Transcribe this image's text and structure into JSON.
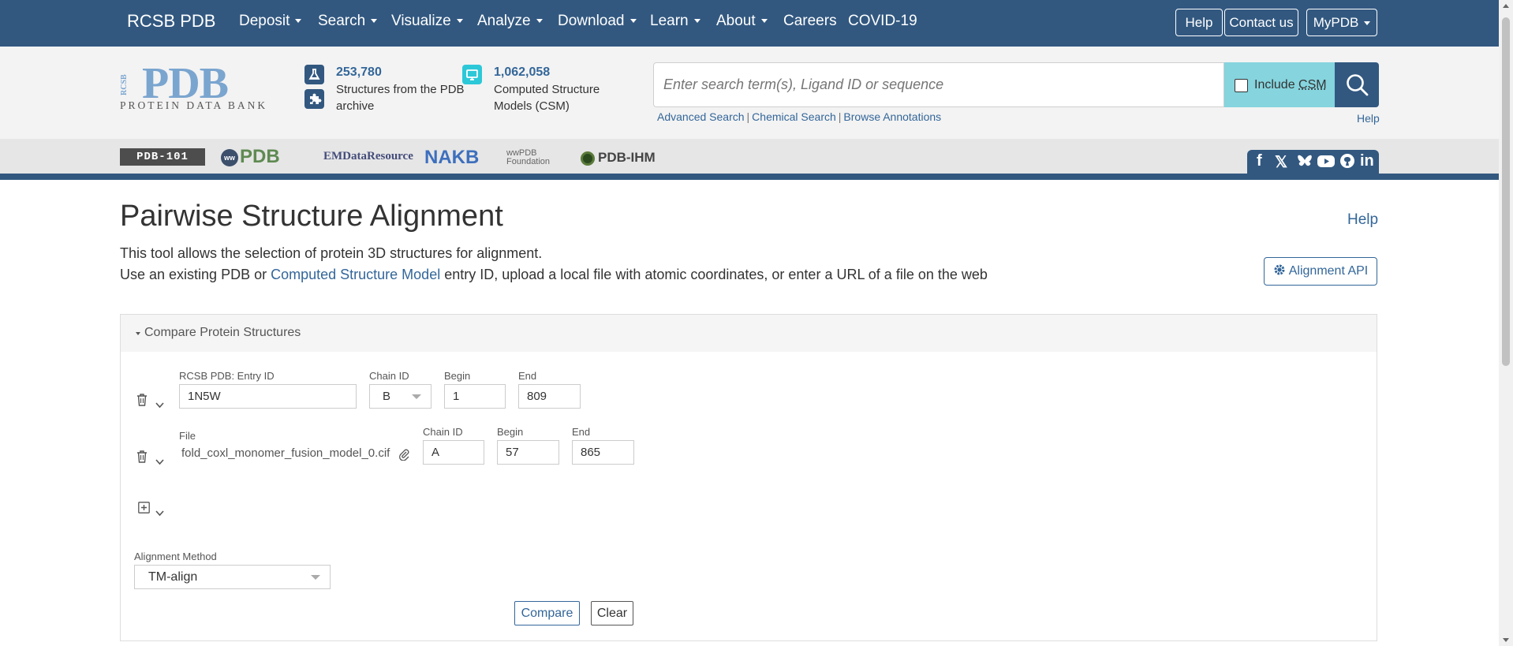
{
  "nav": {
    "brand": "RCSB PDB",
    "items": [
      {
        "label": "Deposit",
        "dropdown": true
      },
      {
        "label": "Search",
        "dropdown": true
      },
      {
        "label": "Visualize",
        "dropdown": true
      },
      {
        "label": "Analyze",
        "dropdown": true
      },
      {
        "label": "Download",
        "dropdown": true
      },
      {
        "label": "Learn",
        "dropdown": true
      },
      {
        "label": "About",
        "dropdown": true
      },
      {
        "label": "Careers",
        "dropdown": false
      },
      {
        "label": "COVID-19",
        "dropdown": false
      }
    ],
    "help_label": "Help",
    "contact_label": "Contact us",
    "mypdb_label": "MyPDB"
  },
  "header": {
    "logo": {
      "main": "PDB",
      "vertical": "RCSB",
      "subtitle": "PROTEIN DATA BANK"
    },
    "stats": {
      "structures_count": "253,780",
      "structures_text": "Structures from the PDB archive",
      "csm_count": "1,062,058",
      "csm_text": "Computed Structure Models (CSM)"
    },
    "search": {
      "placeholder": "Enter search term(s), Ligand ID or sequence",
      "include_label": "Include",
      "include_abbr": "CSM",
      "include_checked": false,
      "links": [
        "Advanced Search",
        "Chemical Search",
        "Browse Annotations"
      ],
      "help": "Help"
    }
  },
  "members": {
    "pdb101": "PDB-101",
    "wwpdb": "PDB",
    "wwpdb_ww": "ww",
    "emdb": "EMDataResource",
    "nakb": "NAKB",
    "wwpdb_foundation_1": "wwPDB",
    "wwpdb_foundation_2": "Foundation",
    "pdbihm": "PDB-IHM",
    "social_icons": [
      "facebook-icon",
      "x-icon",
      "bluesky-icon",
      "youtube-icon",
      "github-icon",
      "linkedin-icon"
    ]
  },
  "main": {
    "title": "Pairwise Structure Alignment",
    "help": "Help",
    "desc1": "This tool allows the selection of protein 3D structures for alignment.",
    "desc2_pre": "Use an existing PDB or ",
    "desc2_link": "Computed Structure Model",
    "desc2_post": " entry ID, upload a local file with atomic coordinates, or enter a URL of a file on the web",
    "api_label": "Alignment API"
  },
  "panel": {
    "title": "Compare Protein Structures",
    "row1": {
      "entry_label": "RCSB PDB: Entry ID",
      "entry_value": "1N5W",
      "chain_label": "Chain ID",
      "chain_value": "B",
      "begin_label": "Begin",
      "begin_value": "1",
      "end_label": "End",
      "end_value": "809"
    },
    "row2": {
      "file_label": "File",
      "file_value": "fold_coxl_monomer_fusion_model_0.cif",
      "chain_label": "Chain ID",
      "chain_value": "A",
      "begin_label": "Begin",
      "begin_value": "57",
      "end_label": "End",
      "end_value": "865"
    },
    "method_label": "Alignment Method",
    "method_value": "TM-align",
    "compare_label": "Compare",
    "clear_label": "Clear"
  },
  "colors": {
    "nav_bg": "#325880",
    "link": "#336699",
    "csm_accent": "#85d4de"
  }
}
